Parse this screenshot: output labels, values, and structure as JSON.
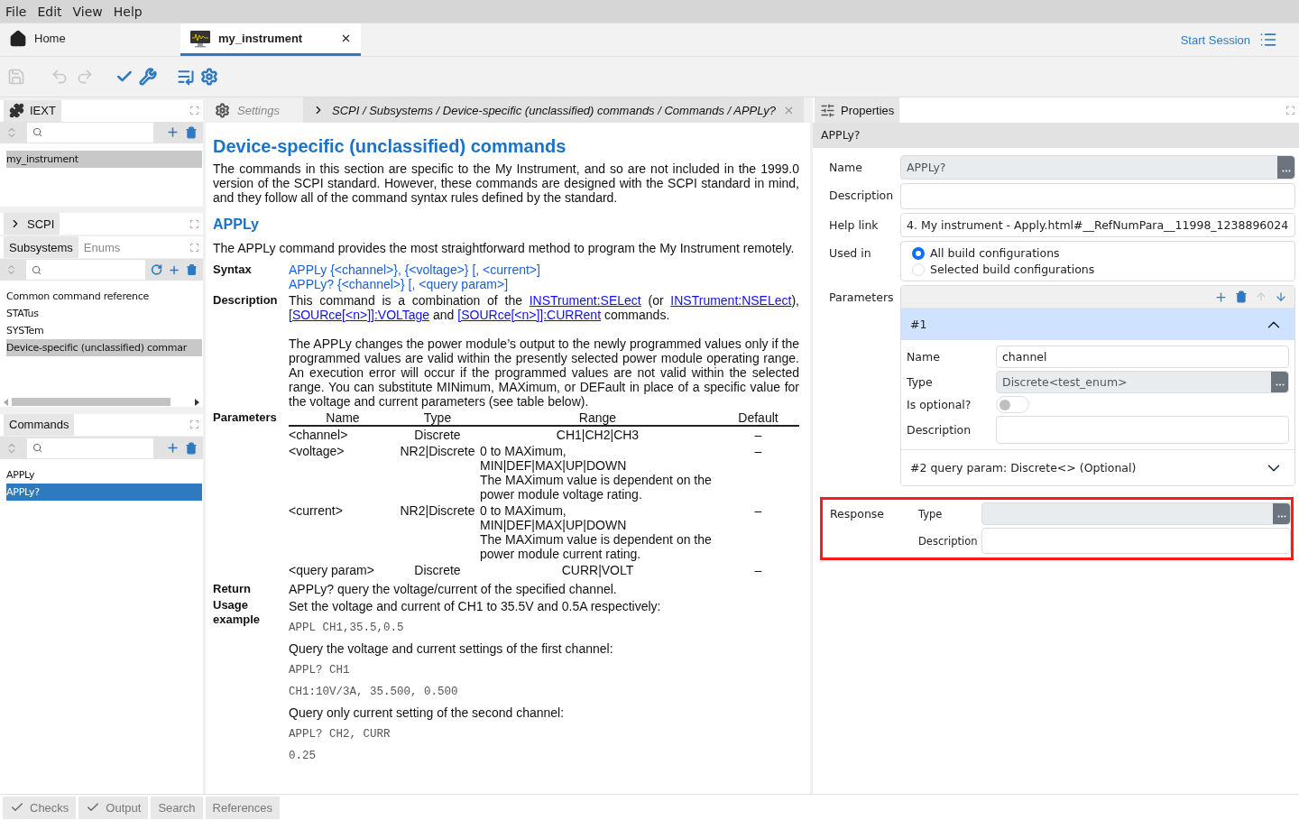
{
  "menu": [
    "File",
    "Edit",
    "View",
    "Help"
  ],
  "doc_tabs": [
    {
      "label": "Home",
      "kind": "home",
      "selected": false,
      "closable": false
    },
    {
      "label": "my_instrument",
      "kind": "instrument",
      "selected": true,
      "closable": true
    }
  ],
  "session": {
    "label": "Start Session"
  },
  "toolbar": [
    {
      "kind": "save",
      "disabled": true
    },
    {
      "kind": "undo",
      "disabled": true
    },
    {
      "kind": "redo",
      "disabled": true
    },
    {
      "kind": "check",
      "disabled": false
    },
    {
      "kind": "wrench",
      "disabled": false
    },
    {
      "kind": "list",
      "disabled": false
    },
    {
      "kind": "gear",
      "disabled": false
    }
  ],
  "iext": {
    "tab": "IEXT",
    "focused": false,
    "items": [
      {
        "label": "my_instrument",
        "selected": true
      }
    ]
  },
  "scpi": {
    "title": "SCPI",
    "tabs": [
      {
        "label": "Subsystems",
        "selected": true
      },
      {
        "label": "Enums",
        "selected": false
      }
    ],
    "focused": false,
    "items": [
      {
        "label": "Common command reference",
        "selected": false
      },
      {
        "label": "STATus",
        "selected": false
      },
      {
        "label": "SYSTem",
        "selected": false
      },
      {
        "label": "Device-specific (unclassified) commar",
        "selected": true
      }
    ]
  },
  "commands": {
    "tab": "Commands",
    "focused": true,
    "items": [
      {
        "label": "APPLy",
        "selected": false
      },
      {
        "label": "APPLy?",
        "selected": true
      }
    ]
  },
  "editor_tabs": [
    {
      "kind": "settings",
      "label": "Settings",
      "selected": false
    },
    {
      "kind": "path",
      "label": "SCPI / Subsystems / Device-specific (unclassified) commands / Commands / APPLy?",
      "selected": true
    }
  ],
  "doc": {
    "heading": "Device-specific (unclassified) commands",
    "intro": "The commands in this section are specific to the My Instrument, and so are not included in the 1999.0 version of the SCPI standard. However, these commands are designed with the SCPI standard in mind, and they follow all of the command syntax rules defined by the standard.",
    "subheading": "APPLy",
    "summary": "The APPLy command provides the most straightforward method to program the My Instrument remotely.",
    "syntax_label": "Syntax",
    "syntax": [
      "APPLy {<channel>}, {<voltage>} [, <current>]",
      "APPLy? {<channel>} [, <query param>]"
    ],
    "description_label": "Description",
    "description": [
      {
        "text": "This command is a combination of the ",
        "link": false
      },
      {
        "text": "INSTrument:SELect",
        "link": true
      },
      {
        "text": " (or ",
        "link": false
      },
      {
        "text": "INSTrument:NSELect",
        "link": true
      },
      {
        "text": "), ",
        "link": false
      },
      {
        "text": "[SOURce[<n>]]:VOLTage",
        "link": true
      },
      {
        "text": " and ",
        "link": false
      },
      {
        "text": "[SOURce[<n>]]:CURRent",
        "link": true
      },
      {
        "text": " commands.",
        "link": false
      }
    ],
    "description_2": "The APPLy changes the power module’s output to the newly programmed values only if the programmed values are valid within the presently selected power module operating range. An execution error will occur if the programmed values are not valid within the selected range. You can substitute MINimum, MAXimum, or DEFault in place of a specific value for the voltage and current parameters (see table below).",
    "parameters_label": "Parameters",
    "param_columns": [
      "Name",
      "Type",
      "Range",
      "Default"
    ],
    "params": [
      {
        "name": "<channel>",
        "type": "Discrete",
        "range": [
          "CH1|CH2|CH3"
        ],
        "default": "–"
      },
      {
        "name": "<voltage>",
        "type": "NR2|Discrete",
        "range": [
          "0 to MAXimum,",
          "MIN|DEF|MAX|UP|DOWN",
          "The MAXimum value is dependent on the power module voltage rating."
        ],
        "default": "–"
      },
      {
        "name": "<current>",
        "type": "NR2|Discrete",
        "range": [
          "0 to MAXimum,",
          "MIN|DEF|MAX|UP|DOWN",
          "The MAXimum value is dependent on the power module current rating."
        ],
        "default": "–"
      },
      {
        "name": "<query param>",
        "type": "Discrete",
        "range": [
          "CURR|VOLT"
        ],
        "default": "–"
      }
    ],
    "return_label": "Return",
    "return": "APPLy? query the voltage/current of the specified channel.",
    "usage_label": "Usage example",
    "usage": [
      {
        "kind": "text",
        "text": "Set the voltage and current of CH1 to 35.5V and 0.5A respectively:"
      },
      {
        "kind": "code",
        "text": "APPL CH1,35.5,0.5"
      },
      {
        "kind": "text",
        "text": "Query the voltage and current settings of the first channel:"
      },
      {
        "kind": "code",
        "text": "APPL? CH1"
      },
      {
        "kind": "code",
        "text": "CH1:10V/3A, 35.500, 0.500"
      },
      {
        "kind": "text",
        "text": "Query only current setting of the second channel:"
      },
      {
        "kind": "code",
        "text": "APPL? CH2, CURR"
      },
      {
        "kind": "code",
        "text": "0.25"
      }
    ]
  },
  "properties": {
    "tab": "Properties",
    "header": "APPLy?",
    "name_label": "Name",
    "name": "APPLy?",
    "description_label": "Description",
    "help_label": "Help link",
    "help": "4. My instrument - Apply.html#__RefNumPara__11998_1238896024",
    "used_label": "Used in",
    "used_options": [
      {
        "label": "All build configurations",
        "selected": true
      },
      {
        "label": "Selected build configurations",
        "selected": false
      }
    ],
    "parameters_label": "Parameters",
    "parameters": [
      {
        "label": "#1",
        "expanded": true,
        "name_label": "Name",
        "name": "channel",
        "type_label": "Type",
        "type": "Discrete<test_enum>",
        "optional_label": "Is optional?",
        "optional": false,
        "description_label": "Description"
      },
      {
        "label": "#2  query param: Discrete<> (Optional)",
        "expanded": false
      }
    ],
    "response": {
      "label": "Response",
      "highlighted": true,
      "type_label": "Type",
      "description_label": "Description"
    }
  },
  "bottom_tabs": [
    {
      "label": "Checks",
      "kind": "check"
    },
    {
      "label": "Output",
      "kind": "check"
    },
    {
      "label": "Search",
      "kind": "plain"
    },
    {
      "label": "References",
      "kind": "plain"
    }
  ]
}
